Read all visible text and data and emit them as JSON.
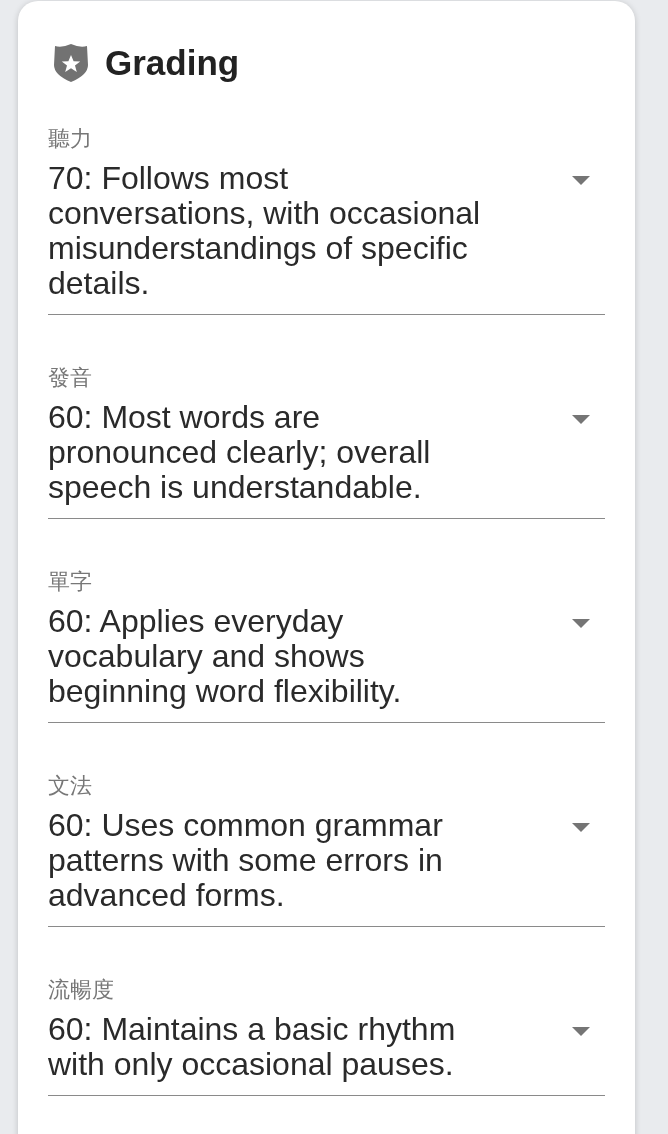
{
  "card": {
    "title": "Grading"
  },
  "fields": [
    {
      "label": "聽力",
      "value": "70: Follows most conversations, with occasional misunderstandings of specific details."
    },
    {
      "label": "發音",
      "value": "60: Most words are pronounced clearly; overall speech is understandable."
    },
    {
      "label": "單字",
      "value": "60: Applies everyday vocabulary and shows beginning word flexibility."
    },
    {
      "label": "文法",
      "value": "60: Uses common grammar patterns with some errors in advanced forms."
    },
    {
      "label": "流暢度",
      "value": "60: Maintains a basic rhythm with only occasional pauses."
    }
  ]
}
